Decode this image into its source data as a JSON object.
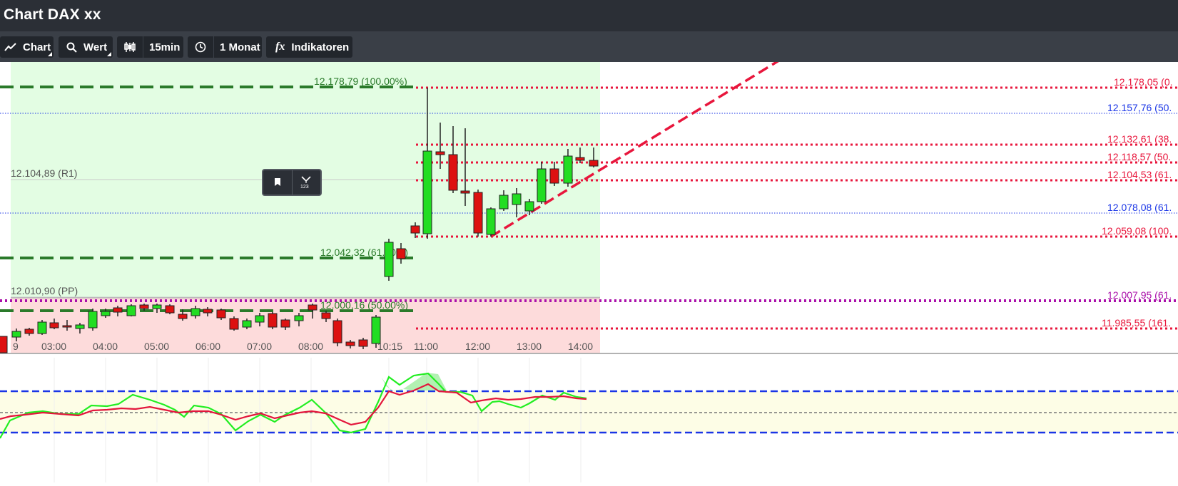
{
  "window": {
    "title": "Chart DAX xx"
  },
  "toolbar": {
    "chart_label": "Chart",
    "value_label": "Wert",
    "interval_label": "15min",
    "range_label": "1 Monat",
    "indicators_label": "Indikatoren",
    "indicators_glyph": "fx"
  },
  "icons": {
    "chart": "line-chart-icon",
    "value": "search-icon",
    "interval": "candlestick-icon",
    "range": "clock-icon",
    "bookmark": "bookmark-icon",
    "measure": "measure-icon"
  },
  "colors": {
    "bull": "#22dd22",
    "bear": "#dd1111",
    "fib_green": "#2a7a2a",
    "fib_red": "#e8163c",
    "pivot_blue": "#1a35e6",
    "pivot_purple": "#aa10aa",
    "zone_green": "#e3fde3",
    "zone_red": "#fddbdb",
    "rsi_line": "#22ee22",
    "rsi_signal": "#e3163c"
  },
  "levels": {
    "left": [
      {
        "label": "12.178,79 (100.00%)",
        "style": "green-dashed"
      },
      {
        "label": "12.104,89 (R1)",
        "style": "gray-solid"
      },
      {
        "label": "12.042,32 (61.80%)",
        "style": "green-dashed"
      },
      {
        "label": "12.010,90 (PP)",
        "style": "gray-solid"
      },
      {
        "label": "12.000,16 (50.00%)",
        "style": "green-dashed"
      }
    ],
    "right": [
      {
        "label": "12.178,05 (0.",
        "style": "red-dotted"
      },
      {
        "label": "12.157,76 (50.",
        "style": "blue-dotted"
      },
      {
        "label": "12.132,61 (38.",
        "style": "red-dotted"
      },
      {
        "label": "12.118,57 (50.",
        "style": "red-dotted"
      },
      {
        "label": "12.104,53 (61.",
        "style": "red-dotted"
      },
      {
        "label": "12.078,08 (61.",
        "style": "blue-dotted"
      },
      {
        "label": "12.059,08 (100.",
        "style": "red-dotted"
      },
      {
        "label": "12.007,95 (61.",
        "style": "purple-dotted"
      },
      {
        "label": "11.985,55 (161.",
        "style": "red-dotted"
      }
    ]
  },
  "xaxis": {
    "ticks": [
      "9",
      "03:00",
      "04:00",
      "05:00",
      "06:00",
      "07:00",
      "08:00",
      "10:15",
      "11:00",
      "12:00",
      "13:00",
      "14:00"
    ]
  }
}
